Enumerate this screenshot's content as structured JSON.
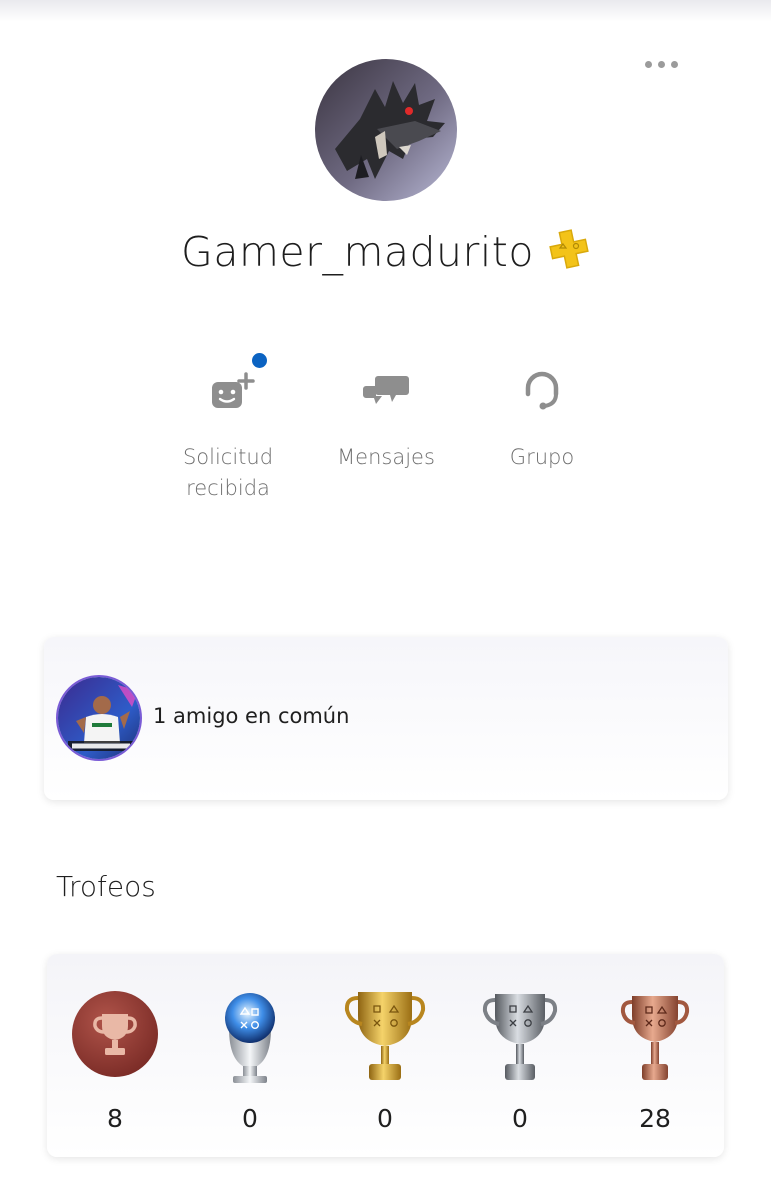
{
  "profile": {
    "username": "Gamer_madurito",
    "avatar_icon": "dragon-avatar-icon",
    "plus_badge_icon": "playstation-plus-icon"
  },
  "actions": [
    {
      "label": "Solicitud recibida",
      "line1": "Solicitud",
      "line2": "recibida",
      "icon": "friend-request-icon",
      "has_notification": true
    },
    {
      "label": "Mensajes",
      "icon": "messages-icon"
    },
    {
      "label": "Grupo",
      "icon": "party-headset-icon"
    }
  ],
  "mutual_friends": {
    "text": "1 amigo en común",
    "avatar_icon": "days-of-play-avatar-icon"
  },
  "trophies": {
    "title": "Trofeos",
    "items": [
      {
        "type": "level",
        "icon": "trophy-level-icon",
        "count": "8"
      },
      {
        "type": "platinum",
        "icon": "platinum-trophy-icon",
        "count": "0"
      },
      {
        "type": "gold",
        "icon": "gold-trophy-icon",
        "count": "0"
      },
      {
        "type": "silver",
        "icon": "silver-trophy-icon",
        "count": "0"
      },
      {
        "type": "bronze",
        "icon": "bronze-trophy-icon",
        "count": "28"
      }
    ]
  },
  "colors": {
    "accent_blue": "#0b63c2",
    "plus_gold": "#f3c319",
    "muted_text": "#6e6e6e"
  }
}
